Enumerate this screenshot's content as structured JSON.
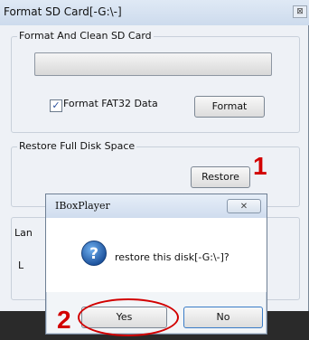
{
  "window": {
    "title": "Format SD Card[-G:\\-]",
    "close_label": "⊠"
  },
  "format_group": {
    "legend": "Format And Clean SD Card",
    "progress": 0,
    "checkbox_label": "Format FAT32 Data",
    "checkbox_mark": "✓",
    "format_button": "Format"
  },
  "restore_group": {
    "legend": "Restore Full Disk Space",
    "restore_button": "Restore"
  },
  "partial_labels": {
    "lang": "Lan",
    "other": "L"
  },
  "annotations": {
    "step1": "1",
    "step2": "2",
    "color": "#d20000"
  },
  "dialog": {
    "title": "IBoxPlayer",
    "close_label": "✕",
    "icon": "question-icon",
    "message": "restore this disk[-G:\\-]?",
    "yes_button": "Yes",
    "no_button": "No"
  }
}
